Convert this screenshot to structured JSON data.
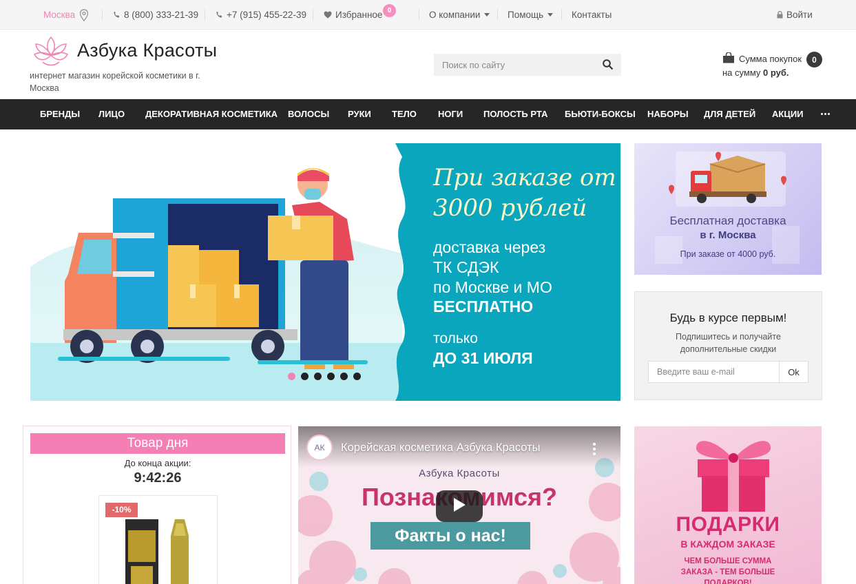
{
  "topbar": {
    "city": "Москва",
    "phone1": "8 (800) 333-21-39",
    "phone2": "+7 (915) 455-22-39",
    "favorites_label": "Избранное",
    "favorites_count": "0",
    "menu_company": "О компании",
    "menu_help": "Помощь",
    "menu_contacts": "Контакты",
    "login": "Войти"
  },
  "header": {
    "logo_text": "Азбука Красоты",
    "tagline": "интернет магазин корейской косметики в г. Москва",
    "search_placeholder": "Поиск по сайту",
    "cart_label": "Сумма покупок",
    "cart_sum_prefix": "на сумму",
    "cart_sum_value": "0 руб.",
    "cart_count": "0"
  },
  "nav": {
    "items": [
      "Бренды",
      "Лицо",
      "Декоративная косметика",
      "Волосы",
      "Руки",
      "Тело",
      "Ноги",
      "Полость рта",
      "Бьюти-боксы",
      "Наборы",
      "Для детей",
      "Акции"
    ]
  },
  "hero": {
    "line1": "При заказе от",
    "line2": "3000 рублей",
    "line3": "доставка через",
    "line4": "ТК СДЭК",
    "line5": "по Москве и МО",
    "line6": "БЕСПЛАТНО",
    "line7": "только",
    "line8": "ДО 31 ИЮЛЯ",
    "slides_total": 6,
    "active_slide": 1
  },
  "delivery_banner": {
    "title": "Бесплатная доставка",
    "city": "в г. Москва",
    "note": "При заказе от 4000 руб."
  },
  "subscribe": {
    "title": "Будь в курсе первым!",
    "description": "Подпишитесь и получайте дополнительные скидки",
    "placeholder": "Введите ваш e-mail",
    "button": "Ok"
  },
  "product_of_day": {
    "title": "Товар дня",
    "countdown_label": "До конца акции:",
    "countdown": "9:42:26",
    "discount": "-10%"
  },
  "video": {
    "channel_avatar": "АК",
    "title": "Корейская косметика Азбука Красоты",
    "brand": "Азбука Красоты",
    "headline": "Познакомимся?",
    "subheadline": "Факты о нас!"
  },
  "gifts_banner": {
    "title": "ПОДАРКИ",
    "subtitle": "В КАЖДОМ ЗАКАЗЕ",
    "note": "ЧЕМ БОЛЬШЕ СУММА ЗАКАЗА - ТЕМ БОЛЬШЕ ПОДАРКОВ!"
  },
  "colors": {
    "accent_pink": "#f47fb5",
    "nav_bg": "#262626",
    "hero_teal": "#0aa6bd"
  }
}
